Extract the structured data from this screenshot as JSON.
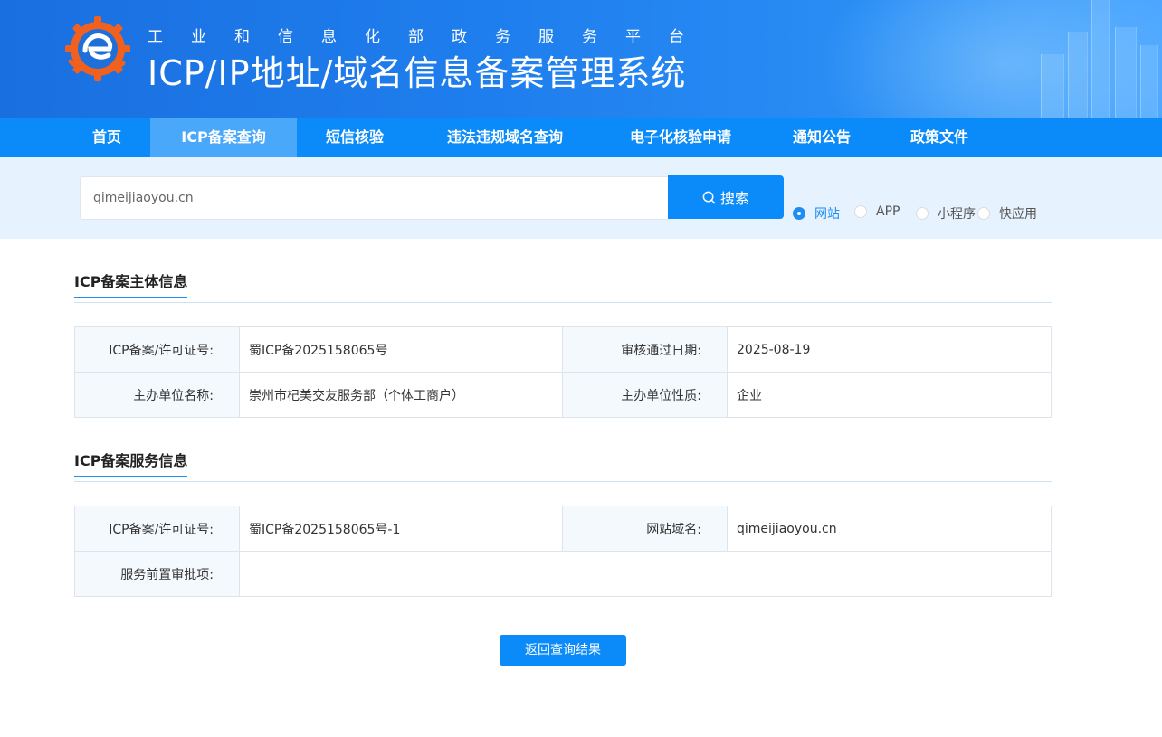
{
  "header": {
    "subtitle": "工业和信息化部政务服务平台",
    "title": "ICP/IP地址/域名信息备案管理系统"
  },
  "nav": [
    {
      "label": "首页"
    },
    {
      "label": "ICP备案查询",
      "active": true
    },
    {
      "label": "短信核验"
    },
    {
      "label": "违法违规域名查询"
    },
    {
      "label": "电子化核验申请"
    },
    {
      "label": "通知公告"
    },
    {
      "label": "政策文件"
    }
  ],
  "search": {
    "value": "qimeijiaoyou.cn",
    "button_label": "搜索",
    "options": [
      {
        "label": "网站",
        "checked": true
      },
      {
        "label": "APP",
        "checked": false
      },
      {
        "label": "小程序",
        "checked": false
      },
      {
        "label": "快应用",
        "checked": false
      }
    ]
  },
  "subject_section": {
    "title": "ICP备案主体信息",
    "license_label": "ICP备案/许可证号:",
    "license_value": "蜀ICP备2025158065号",
    "approve_date_label": "审核通过日期:",
    "approve_date_value": "2025-08-19",
    "org_name_label": "主办单位名称:",
    "org_name_value": "崇州市杞美交友服务部（个体工商户）",
    "org_type_label": "主办单位性质:",
    "org_type_value": "企业"
  },
  "service_section": {
    "title": "ICP备案服务信息",
    "license_label": "ICP备案/许可证号:",
    "license_value": "蜀ICP备2025158065号-1",
    "domain_label": "网站域名:",
    "domain_value": "qimeijiaoyou.cn",
    "preapproval_label": "服务前置审批项:",
    "preapproval_value": ""
  },
  "back_button_label": "返回查询结果",
  "colors": {
    "primary": "#0b8bf9",
    "nav_active": "#4aa8fb",
    "search_band": "#e6f2fd",
    "logo_orange": "#f0611f",
    "logo_blue": "#1e6fd9"
  }
}
